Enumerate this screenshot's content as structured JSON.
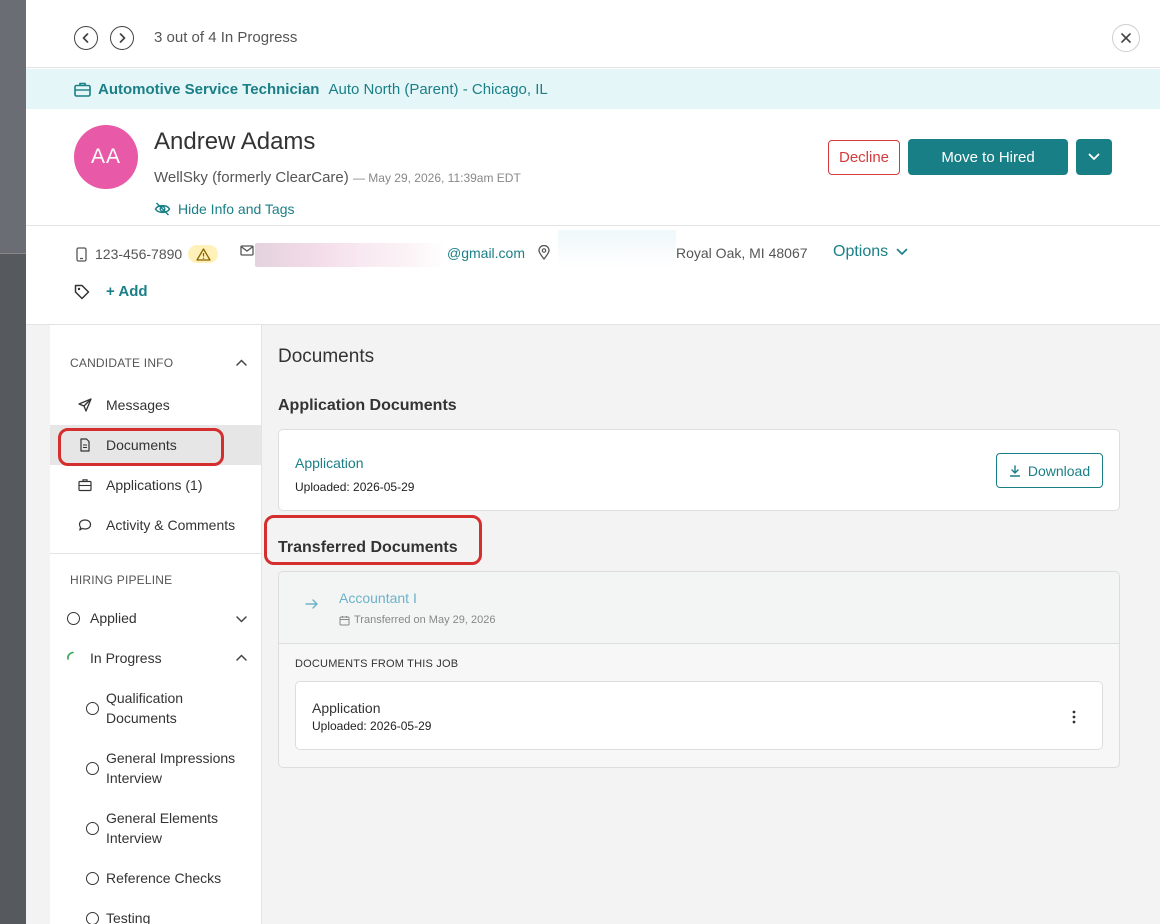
{
  "navigator": {
    "count_text": "3 out of 4 In Progress"
  },
  "job": {
    "title": "Automotive Service Technician",
    "location": "Auto North (Parent) - Chicago, IL"
  },
  "candidate": {
    "initials": "AA",
    "name": "Andrew Adams",
    "source": "WellSky (formerly ClearCare)",
    "applied_meta": "— May 29, 2026, 11:39am EDT",
    "hide_info_label": "Hide Info and Tags"
  },
  "actions": {
    "decline_label": "Decline",
    "hire_label": "Move to Hired"
  },
  "contact": {
    "phone": "123-456-7890",
    "email_suffix": "@gmail.com",
    "address": "Royal Oak, MI 48067",
    "options_label": "Options",
    "add_tag_label": "+ Add"
  },
  "sidebar": {
    "candidate_info_heading": "CANDIDATE INFO",
    "items": [
      {
        "label": "Messages",
        "icon": "send-icon"
      },
      {
        "label": "Documents",
        "icon": "document-icon",
        "active": true
      },
      {
        "label": "Applications (1)",
        "icon": "briefcase-icon"
      },
      {
        "label": "Activity & Comments",
        "icon": "comment-icon"
      }
    ],
    "pipeline_heading": "HIRING PIPELINE",
    "stages": [
      {
        "label": "Applied"
      },
      {
        "label": "In Progress"
      }
    ],
    "sub_stages": [
      {
        "label": "Qualification Documents"
      },
      {
        "label": "General Impressions Interview"
      },
      {
        "label": "General Elements Interview"
      },
      {
        "label": "Reference Checks"
      },
      {
        "label": "Testing"
      }
    ]
  },
  "documents": {
    "title": "Documents",
    "application_heading": "Application Documents",
    "application_doc": {
      "name": "Application",
      "uploaded": "Uploaded: 2026-05-29"
    },
    "download_label": "Download",
    "transferred_heading": "Transferred Documents",
    "transferred_job": {
      "title": "Accountant I",
      "date": "Transferred on May 29, 2026"
    },
    "from_job_label": "DOCUMENTS FROM THIS JOB",
    "transferred_doc": {
      "name": "Application",
      "uploaded": "Uploaded: 2026-05-29"
    }
  },
  "colors": {
    "accent": "#197f86",
    "decline": "#d43b3b",
    "avatar": "#e85aa8",
    "highlight": "#d42e2e"
  }
}
